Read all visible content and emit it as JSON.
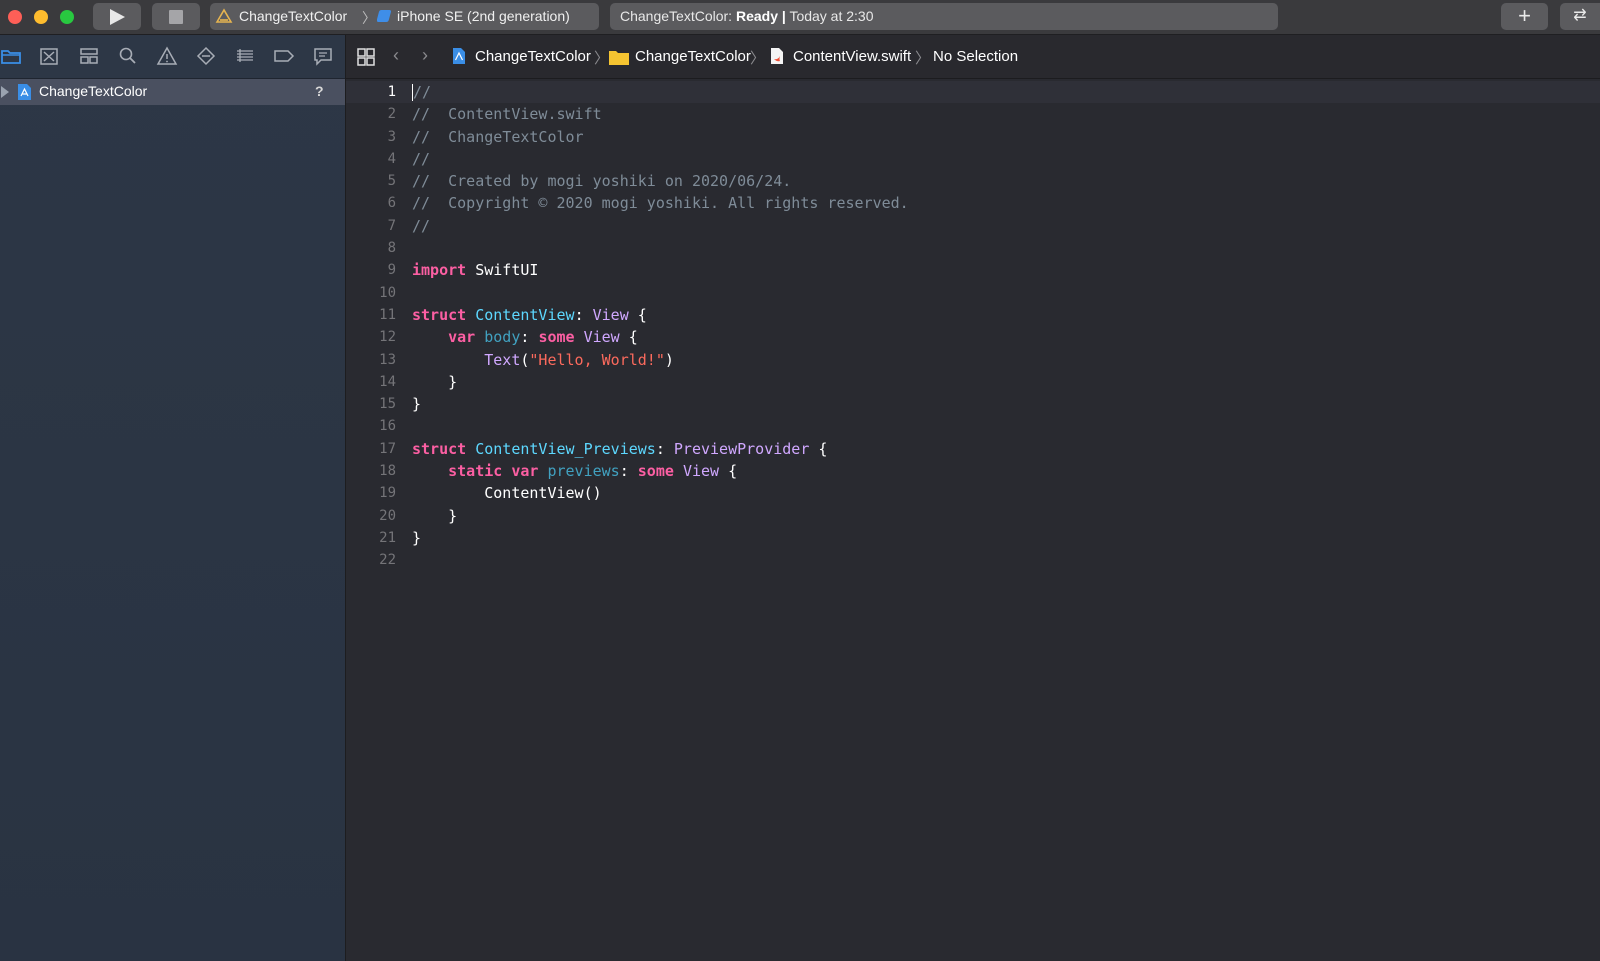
{
  "toolbar": {
    "scheme_name": "ChangeTextColor",
    "device_name": "iPhone SE (2nd generation)",
    "status_project": "ChangeTextColor:",
    "status_state": "Ready",
    "status_sep": "|",
    "status_time": "Today at 2:30",
    "add_label": "+",
    "swap_label": "⇄"
  },
  "navigator": {
    "icons": [
      "folder-icon",
      "source-control-icon",
      "hierarchy-icon",
      "search-icon",
      "warning-icon",
      "test-icon",
      "debug-icon",
      "breakpoint-icon",
      "report-icon"
    ],
    "project_item": {
      "label": "ChangeTextColor",
      "badge": "?"
    }
  },
  "jumpbar": {
    "crumbs": [
      "ChangeTextColor",
      "ChangeTextColor",
      "ContentView.swift",
      "No Selection"
    ]
  },
  "editor": {
    "current_line": 1,
    "lines": [
      "//",
      "//  ContentView.swift",
      "//  ChangeTextColor",
      "//",
      "//  Created by mogi yoshiki on 2020/06/24.",
      "//  Copyright © 2020 mogi yoshiki. All rights reserved.",
      "//",
      "",
      "import SwiftUI",
      "",
      "struct ContentView: View {",
      "    var body: some View {",
      "        Text(\"Hello, World!\")",
      "    }",
      "}",
      "",
      "struct ContentView_Previews: PreviewProvider {",
      "    static var previews: some View {",
      "        ContentView()",
      "    }",
      "}",
      ""
    ]
  },
  "colors": {
    "keyword": "#fc5fa3",
    "type": "#5dd8ff",
    "comment": "#7f8c98",
    "string": "#fc6a5d",
    "accent": "#4a90e2"
  }
}
